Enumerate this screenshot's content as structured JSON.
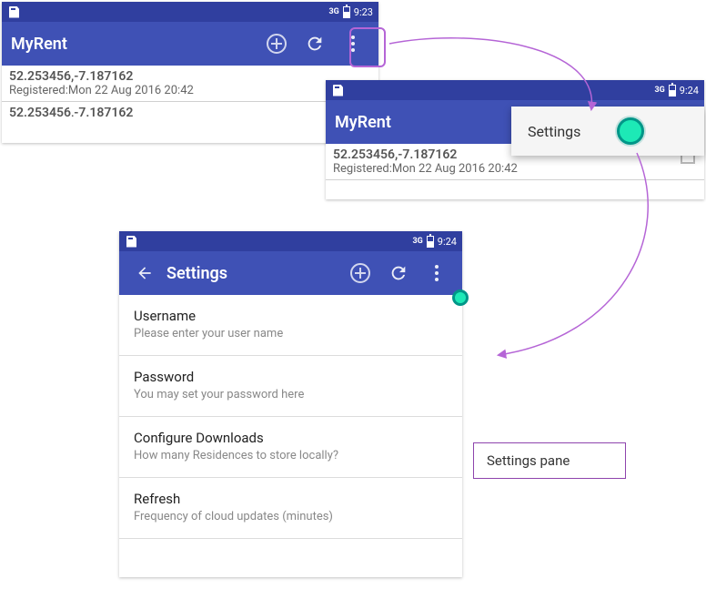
{
  "phone1": {
    "status": {
      "net": "3G",
      "time": "9:23"
    },
    "title": "MyRent",
    "row": {
      "coords": "52.253456,-7.187162",
      "registered": "Registered:Mon 22 Aug 2016 20:42",
      "coords_partial": "52.253456,-7.187162"
    }
  },
  "phone2": {
    "status": {
      "net": "3G",
      "time": "9:24"
    },
    "title": "MyRent",
    "menu_item": "Settings",
    "row": {
      "coords": "52.253456,-7.187162",
      "registered": "Registered:Mon 22 Aug 2016 20:42"
    }
  },
  "phone3": {
    "status": {
      "net": "3G",
      "time": "9:24"
    },
    "title": "Settings",
    "items": [
      {
        "title": "Username",
        "sub": "Please enter your user name"
      },
      {
        "title": "Password",
        "sub": "You may set your password here"
      },
      {
        "title": "Configure Downloads",
        "sub": "How many Residences to store locally?"
      },
      {
        "title": "Refresh",
        "sub": "Frequency of cloud updates (minutes)"
      }
    ]
  },
  "callout": "Settings pane"
}
